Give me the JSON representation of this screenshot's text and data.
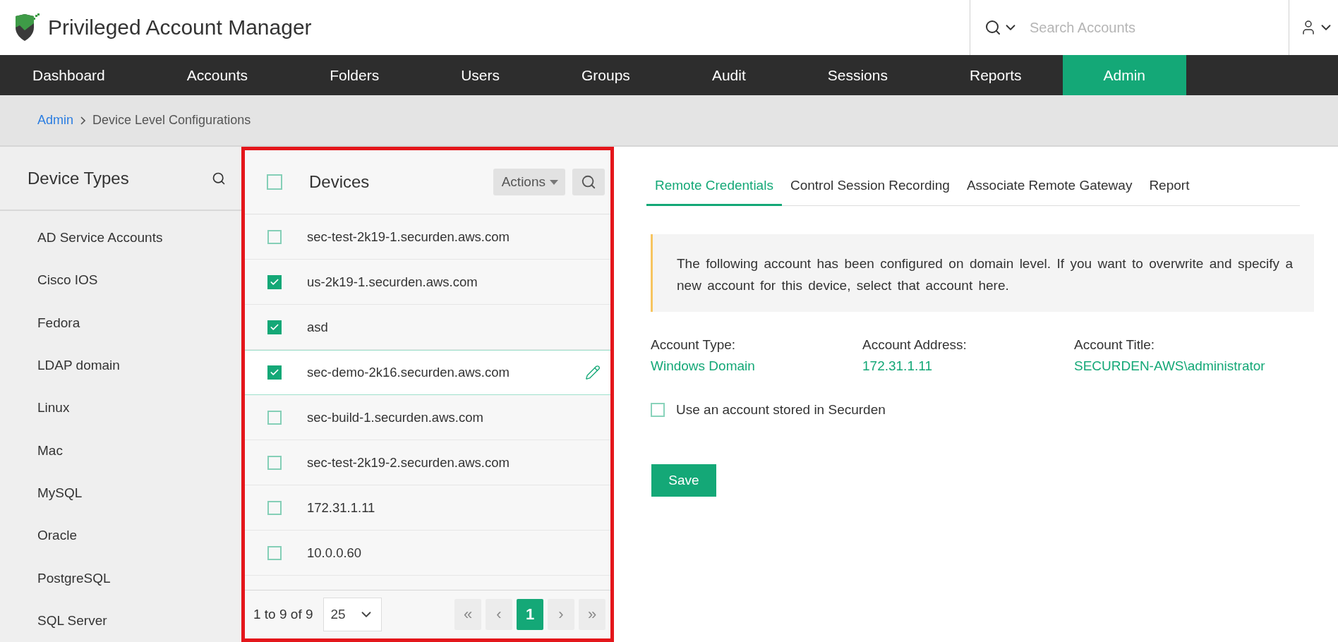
{
  "header": {
    "app_title": "Privileged Account Manager",
    "search": {
      "placeholder": "Search Accounts"
    }
  },
  "nav": [
    {
      "label": "Dashboard",
      "selected": false
    },
    {
      "label": "Accounts",
      "selected": false
    },
    {
      "label": "Folders",
      "selected": false
    },
    {
      "label": "Users",
      "selected": false
    },
    {
      "label": "Groups",
      "selected": false
    },
    {
      "label": "Audit",
      "selected": false
    },
    {
      "label": "Sessions",
      "selected": false
    },
    {
      "label": "Reports",
      "selected": false
    },
    {
      "label": "Admin",
      "selected": true
    }
  ],
  "breadcrumb": {
    "parent": "Admin",
    "current": "Device Level Configurations"
  },
  "sidebar": {
    "title": "Device Types",
    "items": [
      "AD Service Accounts",
      "Cisco IOS",
      "Fedora",
      "LDAP domain",
      "Linux",
      "Mac",
      "MySQL",
      "Oracle",
      "PostgreSQL",
      "SQL Server"
    ]
  },
  "devices": {
    "title": "Devices",
    "select_all_checked": false,
    "actions_label": "Actions",
    "rows": [
      {
        "name": "sec-test-2k19-1.securden.aws.com",
        "checked": false,
        "hovered": false
      },
      {
        "name": "us-2k19-1.securden.aws.com",
        "checked": true,
        "hovered": false
      },
      {
        "name": "asd",
        "checked": true,
        "hovered": false
      },
      {
        "name": "sec-demo-2k16.securden.aws.com",
        "checked": true,
        "hovered": true
      },
      {
        "name": "sec-build-1.securden.aws.com",
        "checked": false,
        "hovered": false
      },
      {
        "name": "sec-test-2k19-2.securden.aws.com",
        "checked": false,
        "hovered": false
      },
      {
        "name": "172.31.1.11",
        "checked": false,
        "hovered": false
      },
      {
        "name": "10.0.0.60",
        "checked": false,
        "hovered": false
      }
    ],
    "pagination": {
      "range": "1 to 9 of 9",
      "page_size": "25",
      "first": {
        "label": "«",
        "disabled": true
      },
      "prev": {
        "label": "‹",
        "disabled": true
      },
      "pages": [
        {
          "label": "1",
          "selected": true
        }
      ],
      "next": {
        "label": "›",
        "disabled": true
      },
      "last": {
        "label": "»",
        "disabled": true
      }
    }
  },
  "tabs": [
    {
      "label": "Remote Credentials",
      "selected": true
    },
    {
      "label": "Control Session Recording",
      "selected": false
    },
    {
      "label": "Associate Remote Gateway",
      "selected": false
    },
    {
      "label": "Report",
      "selected": false
    }
  ],
  "notice": "The following account has been configured on domain level. If you want to overwrite and specify a new account for this device, select that account here.",
  "account_fields": [
    {
      "label": "Account Type:",
      "value": "Windows Domain"
    },
    {
      "label": "Account Address:",
      "value": "172.31.1.11"
    },
    {
      "label": "Account Title:",
      "value": "SECURDEN-AWS\\administrator"
    }
  ],
  "use_stored": {
    "label": "Use an account stored in Securden",
    "checked": false
  },
  "save_label": "Save"
}
